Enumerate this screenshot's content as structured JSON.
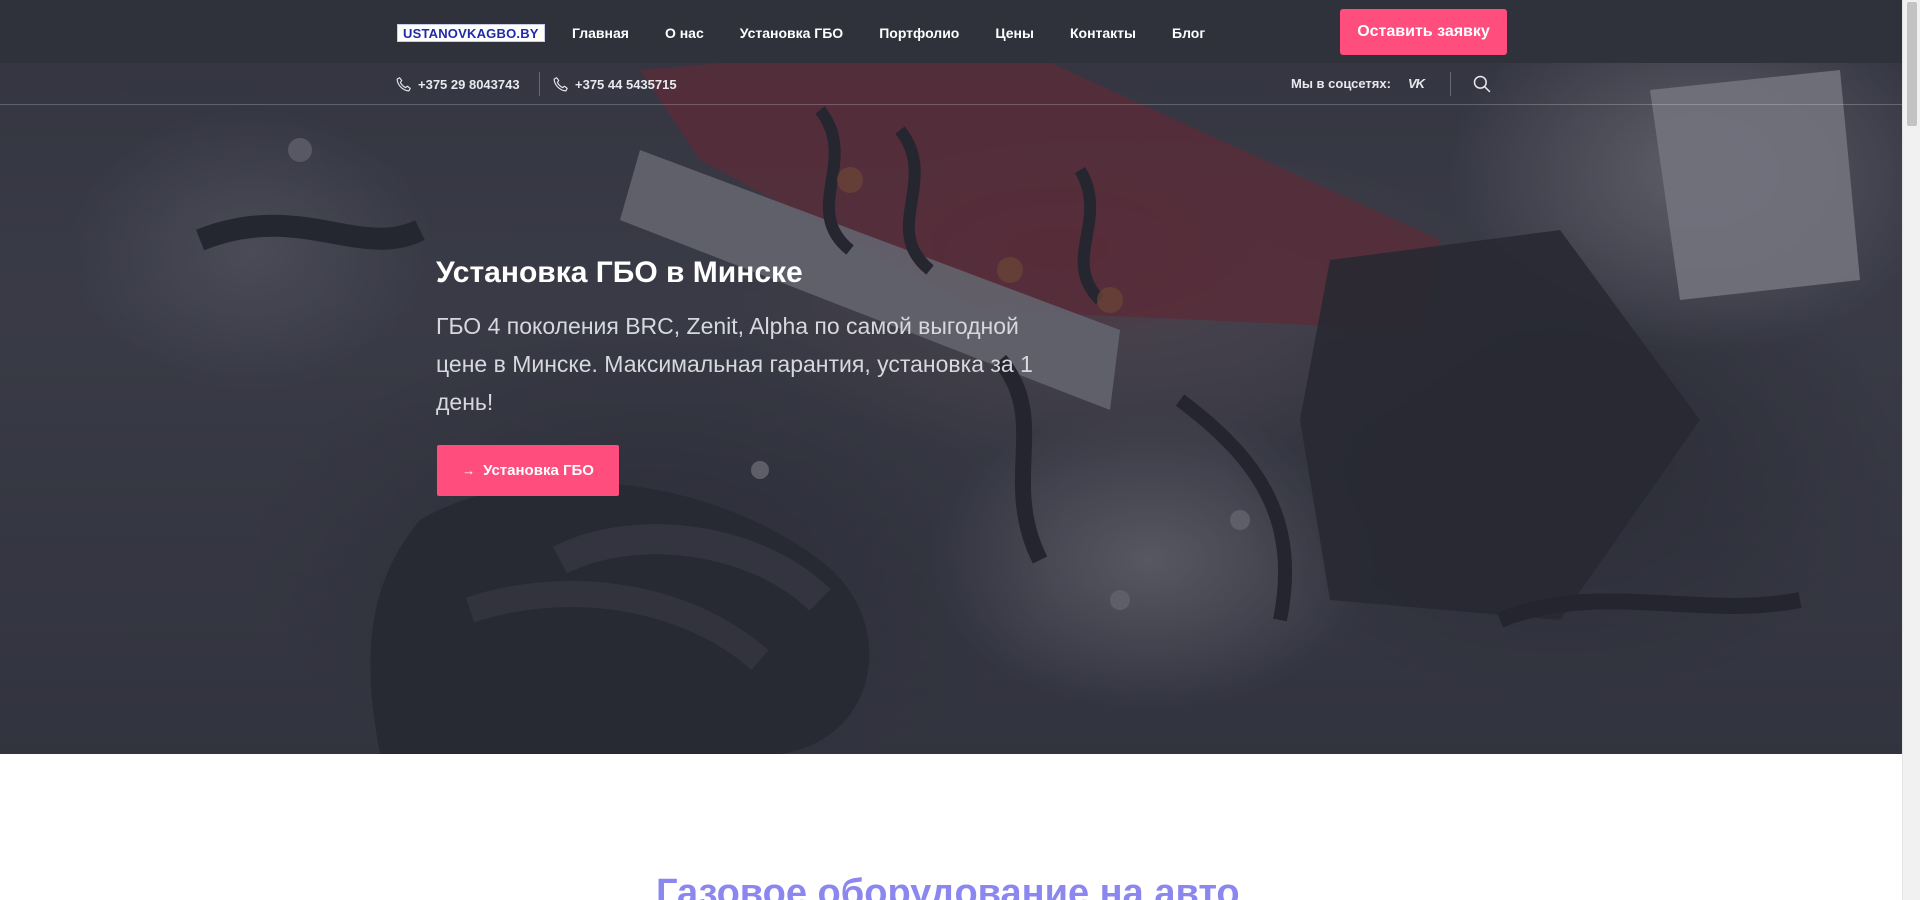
{
  "navbar": {
    "logo": "USTANOVKAGBO.BY",
    "items": [
      {
        "label": "Главная"
      },
      {
        "label": "О нас"
      },
      {
        "label": "Установка ГБО"
      },
      {
        "label": "Портфолио"
      },
      {
        "label": "Цены"
      },
      {
        "label": "Контакты"
      },
      {
        "label": "Блог"
      }
    ],
    "cta_label": "Оставить заявку"
  },
  "contacts": {
    "phone1": "+375 29 8043743",
    "phone2": "+375 44 5435715",
    "social_label": "Мы в соцсетях:",
    "social_icon": "vk-icon",
    "search_icon": "search-icon"
  },
  "hero": {
    "title": "Установка ГБО в Минске",
    "subtitle": "ГБО 4 поколения BRC, Zenit, Alpha по самой выгодной цене в Минске. Максимальная гарантия, установка за 1 день!",
    "button_arrow": "→",
    "button_label": "Установка ГБО"
  },
  "section": {
    "title": "Газовое оборудование на авто"
  },
  "colors": {
    "navbar_bg": "#2f323b",
    "accent": "#ff4d7d",
    "section_title": "#8b87ee",
    "logo_text": "#1f2aa6"
  }
}
